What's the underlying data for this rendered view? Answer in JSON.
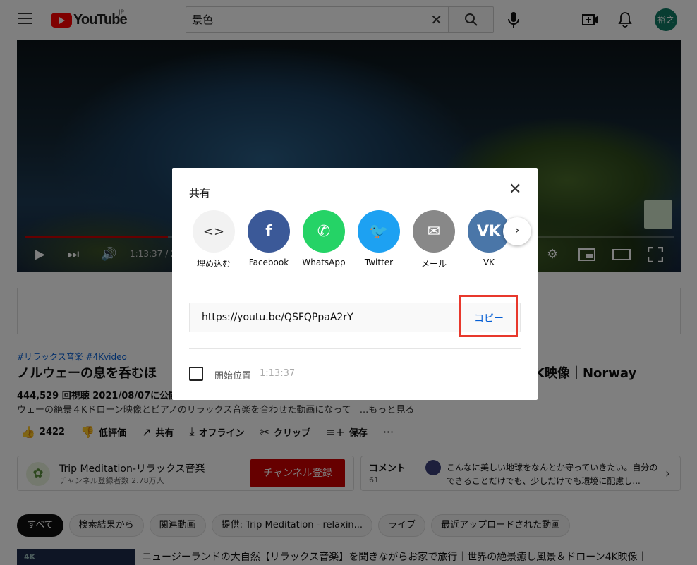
{
  "header": {
    "logo_text": "YouTube",
    "logo_region": "JP",
    "search_value": "景色",
    "clear_glyph": "✕",
    "avatar_text": "裕之"
  },
  "player": {
    "timecode": "1:13:37 / 2",
    "progress_fraction": 0.22
  },
  "video": {
    "tags": "#リラックス音楽 #4Kvideo",
    "title_left": "ノルウェーの息を呑むほ",
    "title_right": "K映像｜Norway",
    "stats": "444,529 回視聴  2021/08/07に公開",
    "description": "ウェーの絶景４Kドローン映像とピアノのリラックス音楽を合わせた動画になって",
    "more": "...もっと見る",
    "actions": [
      {
        "icon": "thumbs-up-icon",
        "glyph": "👍",
        "label": "2422"
      },
      {
        "icon": "thumbs-down-icon",
        "glyph": "👎",
        "label": "低評価"
      },
      {
        "icon": "share-icon",
        "glyph": "↗",
        "label": "共有"
      },
      {
        "icon": "download-icon",
        "glyph": "⤓",
        "label": "オフライン"
      },
      {
        "icon": "scissors-icon",
        "glyph": "✂",
        "label": "クリップ"
      },
      {
        "icon": "playlist-add-icon",
        "glyph": "≡+",
        "label": "保存"
      },
      {
        "icon": "more-icon",
        "glyph": "···",
        "label": ""
      }
    ]
  },
  "channel": {
    "name": "Trip Meditation-リラックス音楽",
    "subscribers": "チャンネル登録者数 2.78万人",
    "subscribe_label": "チャンネル登録"
  },
  "comments": {
    "label": "コメント",
    "count": "61",
    "preview": "こんなに美しい地球をなんとか守っていきたい。自分のできることだけでも、少しだけでも環境に配慮し..."
  },
  "chips": [
    "すべて",
    "検索結果から",
    "関連動画",
    "提供: Trip Meditation - relaxin...",
    "ライブ",
    "最近アップロードされた動画"
  ],
  "recommended": {
    "thumb_label": "4K",
    "title": "ニュージーランドの大自然【リラックス音楽】を聞きながらお家で旅行｜世界の絶景癒し風景＆ドローン4K映像｜"
  },
  "share_dialog": {
    "title": "共有",
    "close_glyph": "✕",
    "targets": [
      {
        "label": "埋め込む",
        "icon": "embed-icon",
        "glyph": "<>",
        "color": "#f2f2f2"
      },
      {
        "label": "Facebook",
        "icon": "facebook-icon",
        "glyph": "f",
        "color": "#3b5998"
      },
      {
        "label": "WhatsApp",
        "icon": "whatsapp-icon",
        "glyph": "✆",
        "color": "#25d366"
      },
      {
        "label": "Twitter",
        "icon": "twitter-icon",
        "glyph": "🐦",
        "color": "#1da1f2"
      },
      {
        "label": "メール",
        "icon": "mail-icon",
        "glyph": "✉",
        "color": "#888888"
      },
      {
        "label": "VK",
        "icon": "vk-icon",
        "glyph": "VK",
        "color": "#4a76a8"
      }
    ],
    "next_glyph": "›",
    "url": "https://youtu.be/QSFQPpaA2rY",
    "copy_label": "コピー",
    "start_at_label": "開始位置",
    "start_at_time": "1:13:37"
  }
}
